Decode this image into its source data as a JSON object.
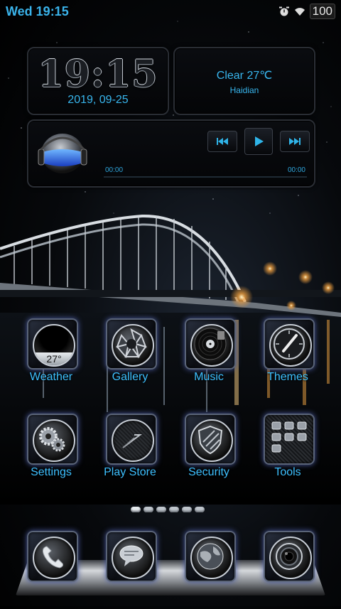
{
  "status_bar": {
    "time": "Wed 19:15",
    "battery": "100"
  },
  "clock_widget": {
    "time": "19:15",
    "date": "2019, 09-25"
  },
  "weather_widget": {
    "condition": "Clear 27℃",
    "location": "Haidian"
  },
  "music_widget": {
    "elapsed": "00:00",
    "duration": "00:00",
    "progress": 0
  },
  "apps": [
    {
      "label": "Weather",
      "icon": "weather-icon",
      "badge": "27°"
    },
    {
      "label": "Gallery",
      "icon": "camera-aperture-icon"
    },
    {
      "label": "Music",
      "icon": "vinyl-record-icon"
    },
    {
      "label": "Themes",
      "icon": "clock-brush-icon"
    },
    {
      "label": "Settings",
      "icon": "gears-icon"
    },
    {
      "label": "Play Store",
      "icon": "play-store-icon"
    },
    {
      "label": "Security",
      "icon": "shield-icon"
    },
    {
      "label": "Tools",
      "icon": "tools-grid-icon"
    }
  ],
  "dock": [
    {
      "icon": "phone-handset-icon"
    },
    {
      "icon": "message-bubble-icon"
    },
    {
      "icon": "globe-icon"
    },
    {
      "icon": "camera-lens-icon"
    }
  ],
  "pages": {
    "count": 6,
    "current": 1
  }
}
